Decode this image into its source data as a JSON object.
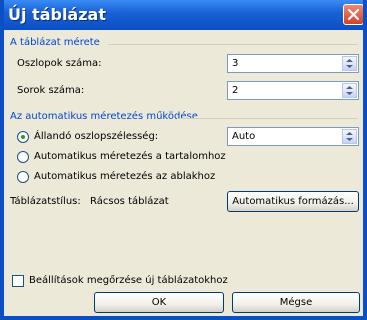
{
  "window": {
    "title": "Új táblázat"
  },
  "size_group": {
    "title": "A táblázat mérete",
    "columns_label": "Oszlopok száma:",
    "columns_value": "3",
    "rows_label": "Sorok száma:",
    "rows_value": "2"
  },
  "autofit_group": {
    "title": "Az automatikus méretezés működése",
    "options": [
      {
        "label": "Állandó oszlopszélesség:",
        "selected": true
      },
      {
        "label": "Automatikus méretezés a tartalomhoz",
        "selected": false
      },
      {
        "label": "Automatikus méretezés az ablakhoz",
        "selected": false
      }
    ],
    "width_value": "Auto"
  },
  "style": {
    "label": "Táblázatstílus:",
    "value": "Rácsos táblázat",
    "format_button": "Automatikus formázás..."
  },
  "remember": {
    "label": "Beállítások megőrzése új táblázatokhoz",
    "checked": false
  },
  "buttons": {
    "ok": "OK",
    "cancel": "Mégse"
  },
  "colors": {
    "title_bar": "#0a4fc4",
    "group_title": "#0046d5",
    "dialog_bg": "#ece9d8"
  }
}
